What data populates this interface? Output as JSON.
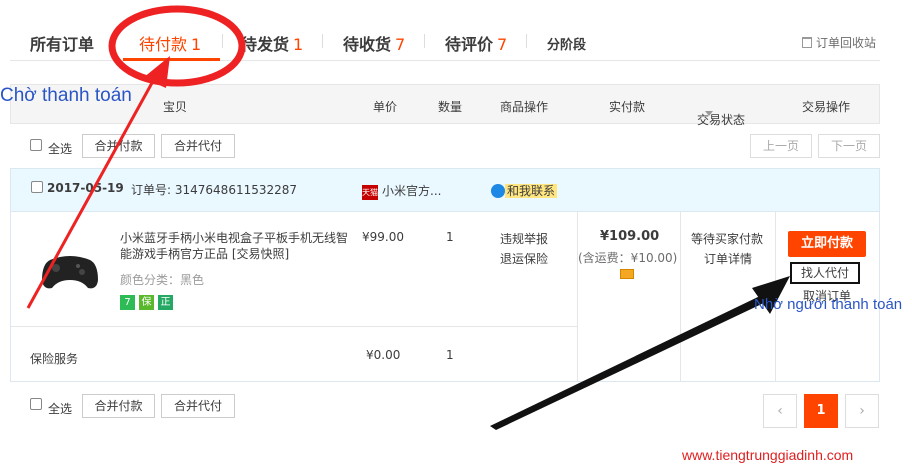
{
  "tabs": [
    {
      "label": "所有订单",
      "count": ""
    },
    {
      "label": "待付款",
      "count": "1"
    },
    {
      "label": "待发货",
      "count": "1"
    },
    {
      "label": "待收货",
      "count": "7"
    },
    {
      "label": "待评价",
      "count": "7"
    },
    {
      "label": "分阶段",
      "count": ""
    }
  ],
  "recycle_label": "订单回收站",
  "annotations": {
    "waiting_payment": "Chờ thanh toán",
    "pay_by_other": "Nhờ người thanh toán",
    "website": "www.tiengtrunggiadinh.com"
  },
  "table_header": {
    "item": "宝贝",
    "price": "单价",
    "qty": "数量",
    "product_ops": "商品操作",
    "paid": "实付款",
    "status": "交易状态",
    "trade_ops": "交易操作"
  },
  "toolbar": {
    "select_all": "全选",
    "merge_pay": "合并付款",
    "merge_proxy_pay": "合并代付",
    "prev_page": "上一页",
    "next_page": "下一页"
  },
  "order": {
    "date": "2017-05-19",
    "order_no_label": "订单号:",
    "order_no": "3147648611532287",
    "shop_badge": "天猫",
    "shop_name": "小米官方...",
    "contact": "和我联系",
    "item_title": "小米蓝牙手柄小米电视盒子平板手机无线智能游戏手柄官方正品 [交易快照]",
    "item_variant": "颜色分类：黑色",
    "item_price": "¥99.00",
    "item_qty": "1",
    "op_report": "违规举报",
    "op_insurance": "退运保险",
    "total": "¥109.00",
    "shipping": "(含运费：¥10.00)",
    "status": "等待买家付款",
    "status_detail": "订单详情",
    "pay_now": "立即付款",
    "proxy_pay": "找人代付",
    "cancel": "取消订单",
    "service_label": "保险服务",
    "service_price": "¥0.00",
    "service_qty": "1",
    "badges": [
      "7",
      "保",
      "正"
    ]
  },
  "pagination": {
    "prev": "‹",
    "current": "1",
    "next": "›"
  },
  "colors": {
    "accent": "#ff4400",
    "annotation_blue": "#2a55c6",
    "annotation_red": "#e02020"
  }
}
